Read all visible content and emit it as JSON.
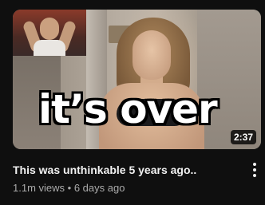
{
  "video": {
    "thumbnail_text": "it’s over",
    "duration": "2:37",
    "title": "This was unthinkable 5 years ago..",
    "views": "1.1m views",
    "separator": "•",
    "age": "6 days ago"
  },
  "icons": {
    "more": "more-vert-icon"
  },
  "colors": {
    "background": "#0f0f0f",
    "title_text": "#f1f1f1",
    "meta_text": "#aaaaaa"
  }
}
